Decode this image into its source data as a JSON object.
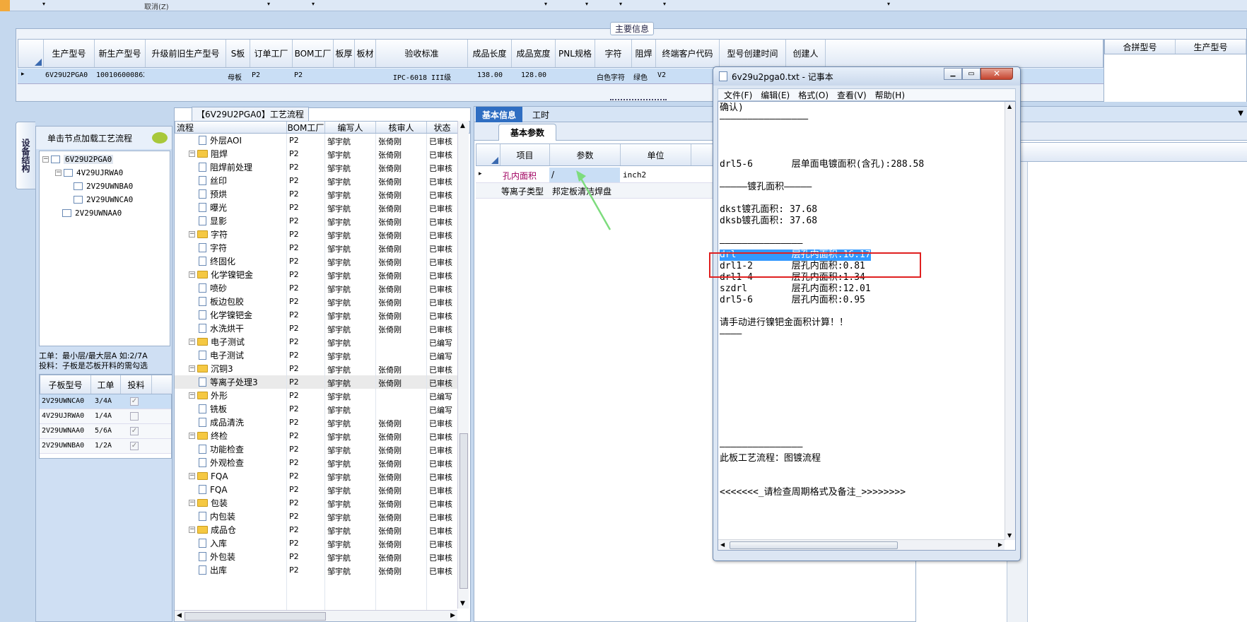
{
  "topbar": {
    "cancel_label": "取消(Z)"
  },
  "main_info": {
    "title": "主要信息",
    "columns": [
      "生产型号",
      "新生产型号",
      "升级前旧生产型号",
      "S板",
      "订单工厂",
      "BOM工厂",
      "板厚",
      "板材",
      "验收标准",
      "成品长度",
      "成品宽度",
      "PNL规格",
      "字符",
      "阻焊",
      "终端客户代码",
      "型号创建时间",
      "创建人"
    ],
    "row": [
      "6V29U2PGA0",
      "10010600086297",
      "",
      "母板",
      "P2",
      "P2",
      "",
      "",
      "IPC-6018 III级",
      "138.00",
      "128.00",
      "",
      "白色字符",
      "绿色",
      "V2"
    ],
    "right_columns": [
      "合拼型号",
      "生产型号"
    ]
  },
  "side_tab": {
    "label": "设备结构"
  },
  "left_panel": {
    "load_label": "单击节点加载工艺流程",
    "tree": [
      "6V29U2PGA0",
      "4V29UJRWA0",
      "2V29UWNBA0",
      "2V29UWNCA0",
      "2V29UWNAA0"
    ],
    "note_line1": "工单：最小层/最大层A 如:2/7A",
    "note_line2": "投料：子板是芯板开料的需勾选",
    "table_headers": [
      "子板型号",
      "工单",
      "投料"
    ],
    "table_rows": [
      {
        "model": "2V29UWNCA0",
        "order": "3/4A",
        "checked": true
      },
      {
        "model": "4V29UJRWA0",
        "order": "1/4A",
        "checked": false
      },
      {
        "model": "2V29UWNAA0",
        "order": "5/6A",
        "checked": true
      },
      {
        "model": "2V29UWNBA0",
        "order": "1/2A",
        "checked": true
      }
    ]
  },
  "process": {
    "title": "【6V29U2PGA0】工艺流程",
    "headers": [
      "流程",
      "BOM工厂",
      "编写人",
      "核审人",
      "状态"
    ],
    "rows": [
      {
        "name": "外层AOI",
        "folder": false,
        "bom": "P2",
        "writer": "邹宇航",
        "reviewer": "张倚刚",
        "status": "已审核"
      },
      {
        "name": "阻焊",
        "folder": true,
        "bom": "P2",
        "writer": "邹宇航",
        "reviewer": "张倚刚",
        "status": "已审核"
      },
      {
        "name": "阻焊前处理",
        "folder": false,
        "bom": "P2",
        "writer": "邹宇航",
        "reviewer": "张倚刚",
        "status": "已审核"
      },
      {
        "name": "丝印",
        "folder": false,
        "bom": "P2",
        "writer": "邹宇航",
        "reviewer": "张倚刚",
        "status": "已审核"
      },
      {
        "name": "预烘",
        "folder": false,
        "bom": "P2",
        "writer": "邹宇航",
        "reviewer": "张倚刚",
        "status": "已审核"
      },
      {
        "name": "曝光",
        "folder": false,
        "bom": "P2",
        "writer": "邹宇航",
        "reviewer": "张倚刚",
        "status": "已审核"
      },
      {
        "name": "显影",
        "folder": false,
        "bom": "P2",
        "writer": "邹宇航",
        "reviewer": "张倚刚",
        "status": "已审核"
      },
      {
        "name": "字符",
        "folder": true,
        "bom": "P2",
        "writer": "邹宇航",
        "reviewer": "张倚刚",
        "status": "已审核"
      },
      {
        "name": "字符",
        "folder": false,
        "bom": "P2",
        "writer": "邹宇航",
        "reviewer": "张倚刚",
        "status": "已审核"
      },
      {
        "name": "终固化",
        "folder": false,
        "bom": "P2",
        "writer": "邹宇航",
        "reviewer": "张倚刚",
        "status": "已审核"
      },
      {
        "name": "化学镍钯金",
        "folder": true,
        "bom": "P2",
        "writer": "邹宇航",
        "reviewer": "张倚刚",
        "status": "已审核"
      },
      {
        "name": "喷砂",
        "folder": false,
        "bom": "P2",
        "writer": "邹宇航",
        "reviewer": "张倚刚",
        "status": "已审核"
      },
      {
        "name": "板边包胶",
        "folder": false,
        "bom": "P2",
        "writer": "邹宇航",
        "reviewer": "张倚刚",
        "status": "已审核"
      },
      {
        "name": "化学镍钯金",
        "folder": false,
        "bom": "P2",
        "writer": "邹宇航",
        "reviewer": "张倚刚",
        "status": "已审核"
      },
      {
        "name": "水洗烘干",
        "folder": false,
        "bom": "P2",
        "writer": "邹宇航",
        "reviewer": "张倚刚",
        "status": "已审核"
      },
      {
        "name": "电子测试",
        "folder": true,
        "bom": "P2",
        "writer": "邹宇航",
        "reviewer": "",
        "status": "已编写"
      },
      {
        "name": "电子测试",
        "folder": false,
        "bom": "P2",
        "writer": "邹宇航",
        "reviewer": "",
        "status": "已编写"
      },
      {
        "name": "沉铜3",
        "folder": true,
        "bom": "P2",
        "writer": "邹宇航",
        "reviewer": "张倚刚",
        "status": "已审核"
      },
      {
        "name": "等离子处理3",
        "folder": false,
        "bom": "P2",
        "writer": "邹宇航",
        "reviewer": "张倚刚",
        "status": "已审核"
      },
      {
        "name": "外形",
        "folder": true,
        "bom": "P2",
        "writer": "邹宇航",
        "reviewer": "",
        "status": "已编写"
      },
      {
        "name": "铣板",
        "folder": false,
        "bom": "P2",
        "writer": "邹宇航",
        "reviewer": "",
        "status": "已编写"
      },
      {
        "name": "成品清洗",
        "folder": false,
        "bom": "P2",
        "writer": "邹宇航",
        "reviewer": "张倚刚",
        "status": "已审核"
      },
      {
        "name": "终检",
        "folder": true,
        "bom": "P2",
        "writer": "邹宇航",
        "reviewer": "张倚刚",
        "status": "已审核"
      },
      {
        "name": "功能检查",
        "folder": false,
        "bom": "P2",
        "writer": "邹宇航",
        "reviewer": "张倚刚",
        "status": "已审核"
      },
      {
        "name": "外观检查",
        "folder": false,
        "bom": "P2",
        "writer": "邹宇航",
        "reviewer": "张倚刚",
        "status": "已审核"
      },
      {
        "name": "FQA",
        "folder": true,
        "bom": "P2",
        "writer": "邹宇航",
        "reviewer": "张倚刚",
        "status": "已审核"
      },
      {
        "name": "FQA",
        "folder": false,
        "bom": "P2",
        "writer": "邹宇航",
        "reviewer": "张倚刚",
        "status": "已审核"
      },
      {
        "name": "包装",
        "folder": true,
        "bom": "P2",
        "writer": "邹宇航",
        "reviewer": "张倚刚",
        "status": "已审核"
      },
      {
        "name": "内包装",
        "folder": false,
        "bom": "P2",
        "writer": "邹宇航",
        "reviewer": "张倚刚",
        "status": "已审核"
      },
      {
        "name": "成品仓",
        "folder": true,
        "bom": "P2",
        "writer": "邹宇航",
        "reviewer": "张倚刚",
        "status": "已审核"
      },
      {
        "name": "入库",
        "folder": false,
        "bom": "P2",
        "writer": "邹宇航",
        "reviewer": "张倚刚",
        "status": "已审核"
      },
      {
        "name": "外包装",
        "folder": false,
        "bom": "P2",
        "writer": "邹宇航",
        "reviewer": "张倚刚",
        "status": "已审核"
      },
      {
        "name": "出库",
        "folder": false,
        "bom": "P2",
        "writer": "邹宇航",
        "reviewer": "张倚刚",
        "status": "已审核"
      }
    ]
  },
  "tabs": {
    "basic_info": "基本信息",
    "work_hours": "工时",
    "basic_params": "基本参数"
  },
  "params": {
    "headers": [
      "项目",
      "参数",
      "单位"
    ],
    "rows": [
      {
        "item": "孔内面积",
        "value": "/",
        "unit": "inch2"
      },
      {
        "item": "等离子类型",
        "value": "邦定板清洁焊盘",
        "unit": ""
      }
    ]
  },
  "notepad": {
    "title": "6v29u2pga0.txt - 记事本",
    "menu": [
      "文件(F)",
      "编辑(E)",
      "格式(O)",
      "查看(V)",
      "帮助(H)"
    ],
    "lines": [
      "确认)",
      "————————————————",
      "",
      "",
      "",
      "drl5-6       层单面电镀面积(含孔):288.58",
      "",
      "—————镀孔面积—————",
      "",
      "dkst镀孔面积: 37.68",
      "dksb镀孔面积: 37.68",
      "",
      "———————————————",
      "drl          层孔内面积:16.17",
      "drl1-2       层孔内面积:0.81",
      "drl1-4       层孔内面积:1.34",
      "szdrl        层孔内面积:12.01",
      "drl5-6       层孔内面积:0.95",
      "",
      "请手动进行镍钯金面积计算！！",
      "————",
      "",
      "",
      "",
      "",
      "",
      "",
      "",
      "",
      "",
      "———————————————",
      "此板工艺流程：图镀流程",
      "",
      "",
      "<<<<<<<_请检查周期格式及备注_>>>>>>>>"
    ],
    "highlight_line": 13
  },
  "colors": {
    "selection": "#3399ff",
    "highlight_box": "#e02020",
    "arrow": "#7ddc7d",
    "tab_active": "#2f6ec2"
  }
}
